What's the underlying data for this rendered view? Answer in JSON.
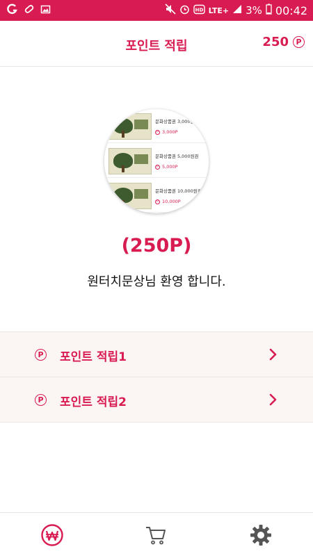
{
  "status_bar": {
    "network": "LTE+",
    "battery_percent": "3%",
    "time": "00:42"
  },
  "header": {
    "title": "포인트 적립",
    "points": "250",
    "point_symbol": "P"
  },
  "hero": {
    "vouchers": [
      {
        "name": "문화상품권 3,000원권",
        "price": "3,000P"
      },
      {
        "name": "문화상품권 5,000원권",
        "price": "5,000P"
      },
      {
        "name": "문화상품권 10,000원권",
        "price": "10,000P"
      }
    ],
    "balance": "(250P)",
    "welcome": "원터치문상님 환영 합니다."
  },
  "menu": {
    "items": [
      {
        "label": "포인트 적립1",
        "icon": "point-icon"
      },
      {
        "label": "포인트 적립2",
        "icon": "point-icon"
      }
    ]
  },
  "bottom_nav": {
    "items": [
      {
        "icon": "won-icon",
        "active": true
      },
      {
        "icon": "cart-icon",
        "active": false
      },
      {
        "icon": "gear-icon",
        "active": false
      }
    ]
  },
  "colors": {
    "accent": "#d81b50",
    "menu_bg": "#fbf6f4",
    "inactive_icon": "#555555"
  }
}
